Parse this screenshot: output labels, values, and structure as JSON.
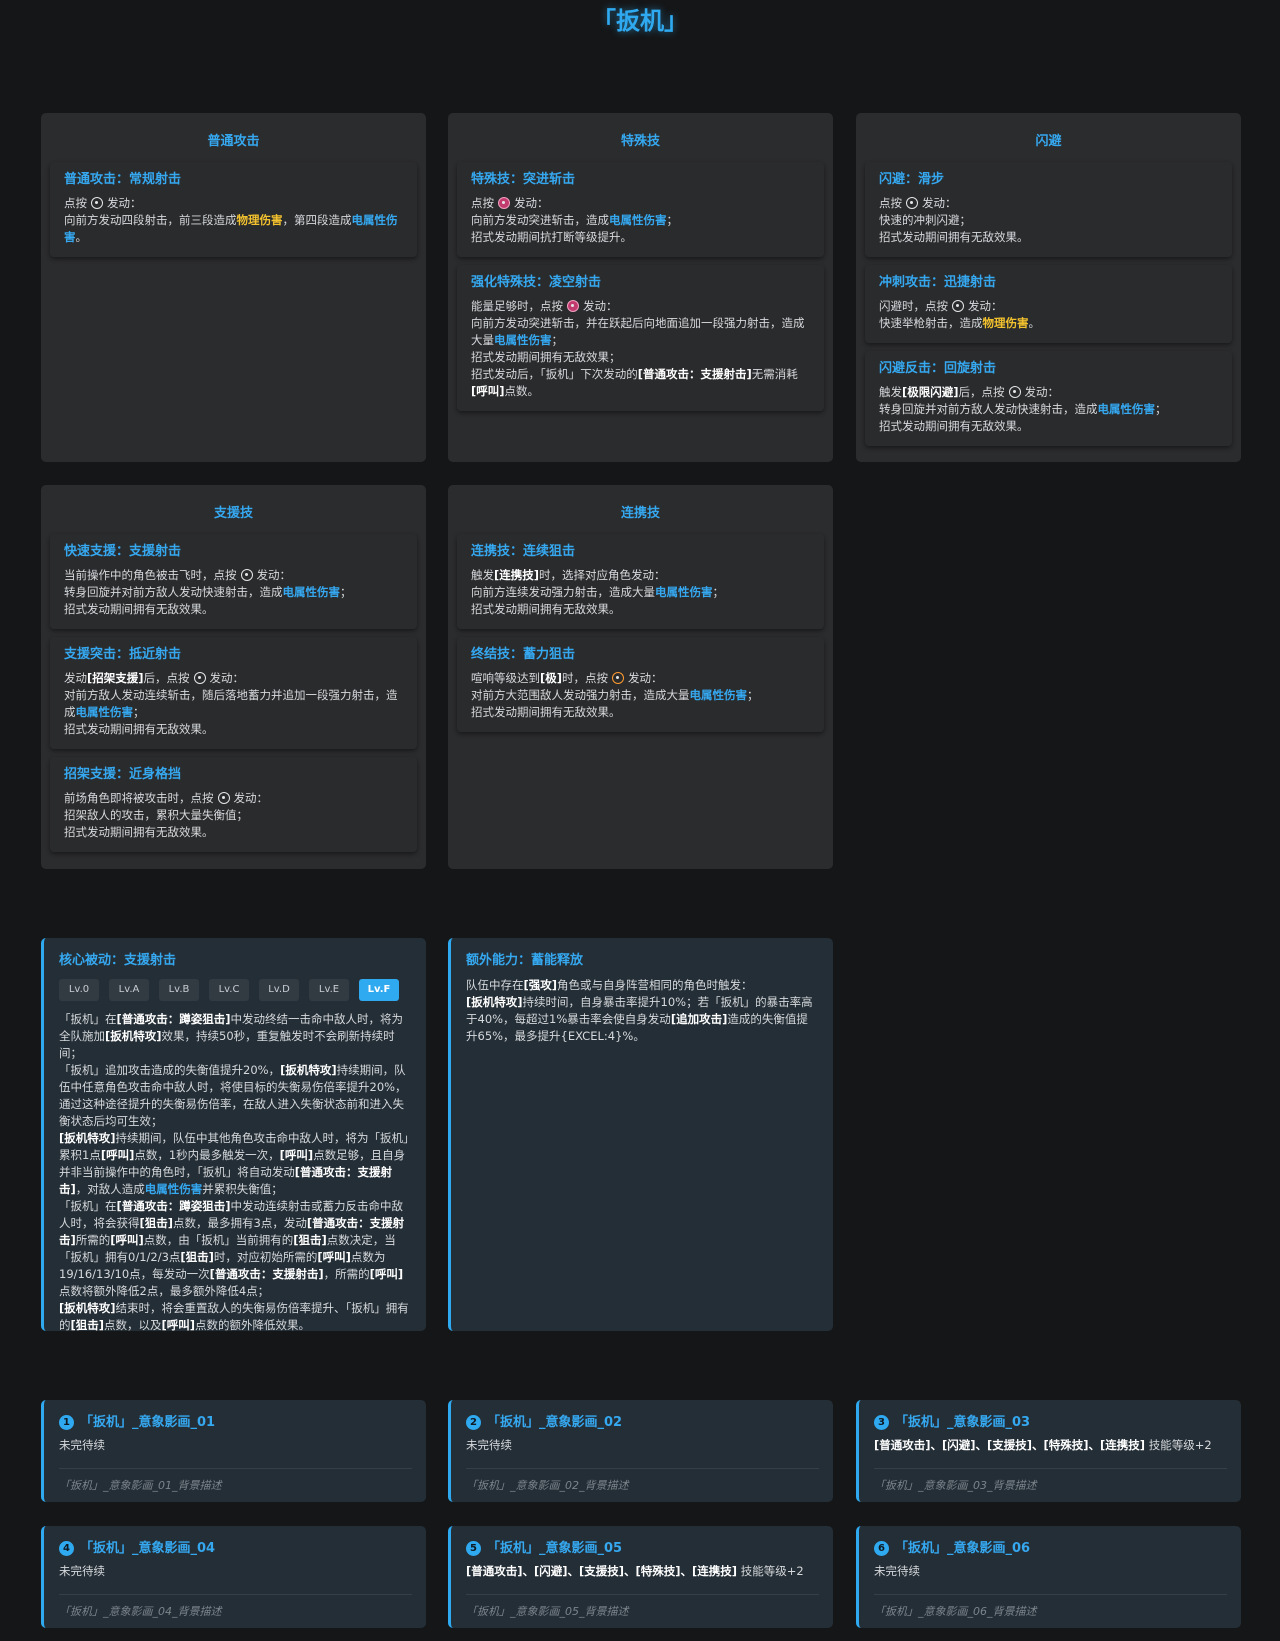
{
  "page_title": "「扳机」",
  "colors": {
    "accent": "#2fa9ef",
    "physical": "#f2c12e",
    "electric": "#35a8f0"
  },
  "icons": {
    "basic": "basic-attack-button-icon",
    "special": "special-attack-button-icon",
    "dodge": "dodge-button-icon",
    "assist": "assist-button-icon",
    "ult": "ultimate-button-icon"
  },
  "panels": {
    "basic": {
      "title": "普通攻击",
      "skills": [
        {
          "name": "普通攻击：常规射击",
          "line1a": "点按",
          "line1b": "发动：",
          "line2a": "向前方发动四段射击，前三段造成",
          "physical": "物理伤害",
          "line2b": "，第四段造成",
          "electric": "电属性伤害",
          "line2c": "。"
        }
      ]
    },
    "special": {
      "title": "特殊技",
      "skills": [
        {
          "name": "特殊技：突进斩击",
          "line1a": "点按",
          "line1b": "发动：",
          "line2a": "向前方发动突进斩击，造成",
          "electric": "电属性伤害",
          "line2b": "；",
          "line3": "招式发动期间抗打断等级提升。"
        },
        {
          "name": "强化特殊技：凌空射击",
          "line1a": "能量足够时，点按",
          "line1b": "发动：",
          "line2a": "向前方发动突进斩击，并在跃起后向地面追加一段强力射击，造成大量",
          "electric": "电属性伤害",
          "line2b": "；",
          "line3": "招式发动期间拥有无敌效果；",
          "line4a": "招式发动后，「扳机」下次发动的",
          "bold1": "[普通攻击：支援射击]",
          "line4b": "无需消耗",
          "bold2": "[呼叫]",
          "line4c": "点数。"
        }
      ]
    },
    "dodge": {
      "title": "闪避",
      "skills": [
        {
          "name": "闪避：滑步",
          "line1a": "点按",
          "line1b": "发动：",
          "line2": "快速的冲刺闪避；",
          "line3": "招式发动期间拥有无敌效果。"
        },
        {
          "name": "冲刺攻击：迅捷射击",
          "line1a": "闪避时，点按",
          "line1b": "发动：",
          "line2a": "快速举枪射击，造成",
          "physical": "物理伤害",
          "line2b": "。"
        },
        {
          "name": "闪避反击：回旋射击",
          "line1a": "触发",
          "bold1": "[极限闪避]",
          "line1b": "后，点按",
          "line1c": "发动：",
          "line2a": "转身回旋并对前方敌人发动快速射击，造成",
          "electric": "电属性伤害",
          "line2b": "；",
          "line3": "招式发动期间拥有无敌效果。"
        }
      ]
    },
    "assist": {
      "title": "支援技",
      "skills": [
        {
          "name": "快速支援：支援射击",
          "line1a": "当前操作中的角色被击飞时，点按",
          "line1b": "发动：",
          "line2a": "转身回旋并对前方敌人发动快速射击，造成",
          "electric": "电属性伤害",
          "line2b": "；",
          "line3": "招式发动期间拥有无敌效果。"
        },
        {
          "name": "支援突击：抵近射击",
          "line1a": "发动",
          "bold1": "[招架支援]",
          "line1b": "后，点按",
          "line1c": "发动：",
          "line2a": "对前方敌人发动连续斩击，随后落地蓄力并追加一段强力射击，造成",
          "electric": "电属性伤害",
          "line2b": "；",
          "line3": "招式发动期间拥有无敌效果。"
        },
        {
          "name": "招架支援：近身格挡",
          "line1a": "前场角色即将被攻击时，点按",
          "line1b": "发动：",
          "line2": "招架敌人的攻击，累积大量失衡值；",
          "line3": "招式发动期间拥有无敌效果。"
        }
      ]
    },
    "chain": {
      "title": "连携技",
      "skills": [
        {
          "name": "连携技：连续狙击",
          "line1a": "触发",
          "bold1": "[连携技]",
          "line1b": "时，选择对应角色发动：",
          "line2a": "向前方连续发动强力射击，造成大量",
          "electric": "电属性伤害",
          "line2b": "；",
          "line3": "招式发动期间拥有无敌效果。"
        },
        {
          "name": "终结技：蓄力狙击",
          "line1a": "喧响等级达到",
          "bold1": "[极]",
          "line1b": "时，点按",
          "line1c": "发动：",
          "line2a": "对前方大范围敌人发动强力射击，造成大量",
          "electric": "电属性伤害",
          "line2b": "；",
          "line3": "招式发动期间拥有无敌效果。"
        }
      ]
    }
  },
  "core": {
    "title": "核心被动：支援射击",
    "levels": [
      "Lv.0",
      "Lv.A",
      "Lv.B",
      "Lv.C",
      "Lv.D",
      "Lv.E",
      "Lv.F"
    ],
    "active_level": "Lv.F",
    "t": {
      "p1": "「扳机」在",
      "p1b": "[普通攻击：蹲姿狙击]",
      "p1c": "中发动终结一击命中敌人时，将为全队施加",
      "p1d": "[扳机特攻]",
      "p1e": "效果，持续50秒，重复触发时不会刷新持续时间；",
      "p2": "「扳机」追加攻击造成的失衡值提升20%，",
      "p2b": "[扳机特攻]",
      "p2c": "持续期间，队伍中任意角色攻击命中敌人时，将使目标的失衡易伤倍率提升20%，通过这种途径提升的失衡易伤倍率，在敌人进入失衡状态前和进入失衡状态后均可生效；",
      "p3b": "[扳机特攻]",
      "p3c": "持续期间，队伍中其他角色攻击命中敌人时，将为「扳机」累积1点",
      "p3d": "[呼叫]",
      "p3e": "点数，1秒内最多触发一次，",
      "p3f": "[呼叫]",
      "p3g": "点数足够，且自身并非当前操作中的角色时，「扳机」将自动发动",
      "p3h": "[普通攻击：支援射击]",
      "p3i": "，对敌人造成",
      "p3j": "电属性伤害",
      "p3k": "并累积失衡值；",
      "p4": "「扳机」在",
      "p4b": "[普通攻击：蹲姿狙击]",
      "p4c": "中发动连续射击或蓄力反击命中敌人时，将会获得",
      "p4d": "[狙击]",
      "p4e": "点数，最多拥有3点，发动",
      "p4f": "[普通攻击：支援射击]",
      "p4g": "所需的",
      "p4h": "[呼叫]",
      "p4i": "点数，由「扳机」当前拥有的",
      "p4j": "[狙击]",
      "p4k": "点数决定，当「扳机」拥有0/1/2/3点",
      "p4l": "[狙击]",
      "p4m": "时，对应初始所需的",
      "p4n": "[呼叫]",
      "p4o": "点数为19/16/13/10点，每发动一次",
      "p4p": "[普通攻击：支援射击]",
      "p4q": "，所需的",
      "p4r": "[呼叫]",
      "p4s": "点数将额外降低2点，最多额外降低4点；",
      "p5b": "[扳机特攻]",
      "p5c": "结束时，将会重置敌人的失衡易伤倍率提升、「扳机」拥有的",
      "p5d": "[狙击]",
      "p5e": "点数，以及",
      "p5f": "[呼叫]",
      "p5g": "点数的额外降低效果。"
    }
  },
  "extra": {
    "title": "额外能力：蓄能释放",
    "t": {
      "a1": "队伍中存在",
      "a1b": "[强攻]",
      "a1c": "角色或与自身阵营相同的角色时触发：",
      "a2b": "[扳机特攻]",
      "a2c": "持续时间，自身暴击率提升10%；若「扳机」的暴击率高于40%，每超过1%暴击率会使自身发动",
      "a2d": "[追加攻击]",
      "a2e": "造成的失衡值提升65%，最多提升{EXCEL:4}%。"
    }
  },
  "mindscapes": [
    {
      "num": "1",
      "title": "「扳机」_意象影画_01",
      "desc": "未完待续",
      "bg": "「扳机」_意象影画_01_背景描述"
    },
    {
      "num": "2",
      "title": "「扳机」_意象影画_02",
      "desc": "未完待续",
      "bg": "「扳机」_意象影画_02_背景描述"
    },
    {
      "num": "3",
      "title": "「扳机」_意象影画_03",
      "desc_bold": "[普通攻击]、[闪避]、[支援技]、[特殊技]、[连携技]",
      "desc_tail": " 技能等级+2",
      "bg": "「扳机」_意象影画_03_背景描述"
    },
    {
      "num": "4",
      "title": "「扳机」_意象影画_04",
      "desc": "未完待续",
      "bg": "「扳机」_意象影画_04_背景描述"
    },
    {
      "num": "5",
      "title": "「扳机」_意象影画_05",
      "desc_bold": "[普通攻击]、[闪避]、[支援技]、[特殊技]、[连携技]",
      "desc_tail": " 技能等级+2",
      "bg": "「扳机」_意象影画_05_背景描述"
    },
    {
      "num": "6",
      "title": "「扳机」_意象影画_06",
      "desc": "未完待续",
      "bg": "「扳机」_意象影画_06_背景描述"
    }
  ]
}
